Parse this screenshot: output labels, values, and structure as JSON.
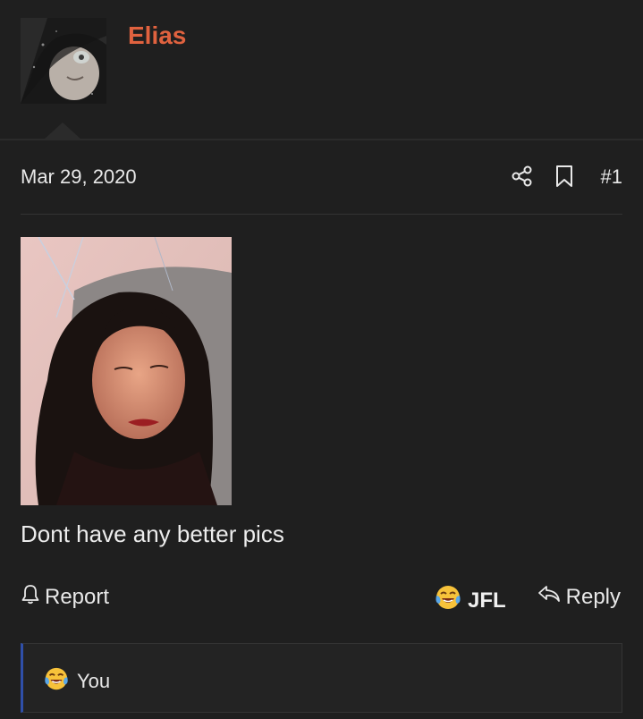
{
  "user": {
    "name": "Elias",
    "avatar_icon": "cat-hood-avatar"
  },
  "post": {
    "date": "Mar 29, 2020",
    "number": "#1",
    "text": "Dont have any better pics",
    "image_icon": "selfie-photo"
  },
  "meta_icons": [
    "share-icon",
    "bookmark-icon"
  ],
  "actions": {
    "report_label": "Report",
    "reaction_label": "JFL",
    "reply_label": "Reply"
  },
  "reactions": {
    "summary": "You",
    "emoji_icon": "tears-of-joy-icon"
  },
  "colors": {
    "background": "#1f1f1f",
    "username": "#e0623f",
    "reaction_bar_accent": "#2f4fa8"
  }
}
